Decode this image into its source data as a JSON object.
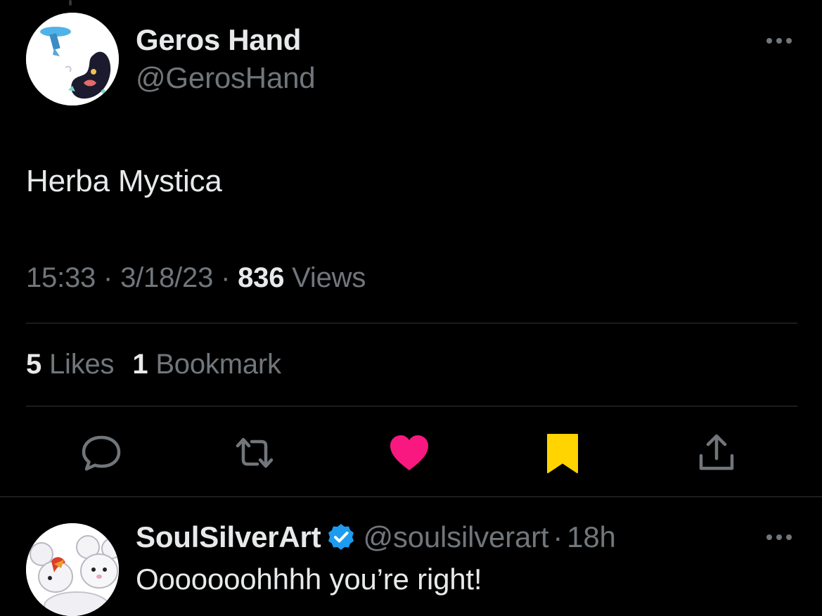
{
  "main_tweet": {
    "author": {
      "name": "Geros Hand",
      "handle": "@GerosHand"
    },
    "text": "Herba Mystica",
    "time": "15:33",
    "date": "3/18/23",
    "separator": "·",
    "views_count": "836",
    "views_label": "Views",
    "likes_count": "5",
    "likes_label": "Likes",
    "bookmarks_count": "1",
    "bookmarks_label": "Bookmark"
  },
  "actions": {
    "reply_icon": "reply-bubble-icon",
    "retweet_icon": "retweet-icon",
    "like_icon": "heart-filled-icon",
    "bookmark_icon": "bookmark-filled-icon",
    "share_icon": "share-icon"
  },
  "reply_tweet": {
    "author": {
      "name": "SoulSilverArt",
      "handle": "@soulsilverart",
      "verified": true
    },
    "separator": "·",
    "time": "18h",
    "text": "Ooooooohhhh you’re right!"
  },
  "colors": {
    "background": "#000000",
    "primary_text": "#e7e9ea",
    "secondary_text": "#71767b",
    "divider": "#2f3336",
    "like": "#f91880",
    "bookmark": "#ffd400",
    "verified": "#1d9bf0"
  }
}
